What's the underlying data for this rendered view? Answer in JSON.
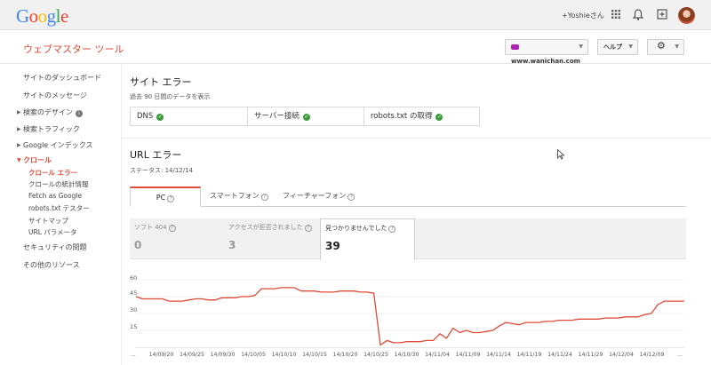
{
  "topbar": {
    "logo": [
      "G",
      "o",
      "o",
      "g",
      "l",
      "e"
    ],
    "user": "+Yoshieさん",
    "icons": [
      "apps-icon",
      "bell-icon",
      "share-icon"
    ]
  },
  "appbar": {
    "title": "ウェブマスター ツール",
    "site": "www.wanichan.com",
    "help": "ヘルプ"
  },
  "sidebar": {
    "items": [
      {
        "label": "サイトのダッシュボード"
      },
      {
        "label": "サイトのメッセージ"
      },
      {
        "label": "検索のデザイン"
      },
      {
        "label": "検索トラフィック"
      },
      {
        "label": "Google インデックス"
      },
      {
        "label": "クロール"
      },
      {
        "label": "クロール エラー"
      },
      {
        "label": "クロールの統計情報"
      },
      {
        "label": "Fetch as Google"
      },
      {
        "label": "robots.txt テスター"
      },
      {
        "label": "サイトマップ"
      },
      {
        "label": "URL パラメータ"
      },
      {
        "label": "セキュリティの問題"
      },
      {
        "label": "その他のリソース"
      }
    ]
  },
  "site_errors": {
    "title": "サイト エラー",
    "subtitle": "過去 90 日間のデータを表示",
    "cells": [
      "DNS",
      "サーバー接続",
      "robots.txt の取得"
    ]
  },
  "url_errors": {
    "title": "URL エラー",
    "status": "ステータス: 14/12/14",
    "tabs": [
      "PC",
      "スマートフォン",
      "フィーチャーフォン"
    ],
    "metrics": [
      {
        "label": "ソフト 404",
        "value": "0"
      },
      {
        "label": "アクセスが拒否されました",
        "value": "3"
      },
      {
        "label": "見つかりませんでした",
        "value": "39"
      }
    ]
  },
  "chart_data": {
    "type": "line",
    "yticks": [
      "60",
      "45",
      "30",
      "15"
    ],
    "ylim": [
      0,
      60
    ],
    "xticks": [
      "...",
      "14/09/20",
      "14/09/25",
      "14/09/30",
      "14/10/05",
      "14/10/10",
      "14/10/15",
      "14/10/20",
      "14/10/25",
      "14/10/30",
      "14/11/04",
      "14/11/09",
      "14/11/14",
      "14/11/19",
      "14/11/24",
      "14/11/29",
      "14/12/04",
      "14/12/09",
      "..."
    ],
    "values": [
      45,
      43,
      43,
      43,
      43,
      41,
      41,
      41,
      42,
      43,
      43,
      42,
      42,
      44,
      44,
      44,
      45,
      45,
      46,
      52,
      52,
      52,
      53,
      53,
      53,
      50,
      50,
      50,
      49,
      49,
      49,
      50,
      50,
      50,
      49,
      49,
      48,
      2,
      6,
      4,
      4,
      5,
      5,
      5,
      6,
      6,
      12,
      8,
      17,
      13,
      15,
      13,
      13,
      14,
      15,
      19,
      22,
      21,
      20,
      22,
      22,
      22,
      23,
      23,
      24,
      24,
      24,
      25,
      25,
      25,
      25,
      26,
      26,
      26,
      27,
      27,
      27,
      29,
      30,
      38,
      41,
      41,
      41,
      41
    ],
    "color": "#dd4b39",
    "grid": true
  }
}
